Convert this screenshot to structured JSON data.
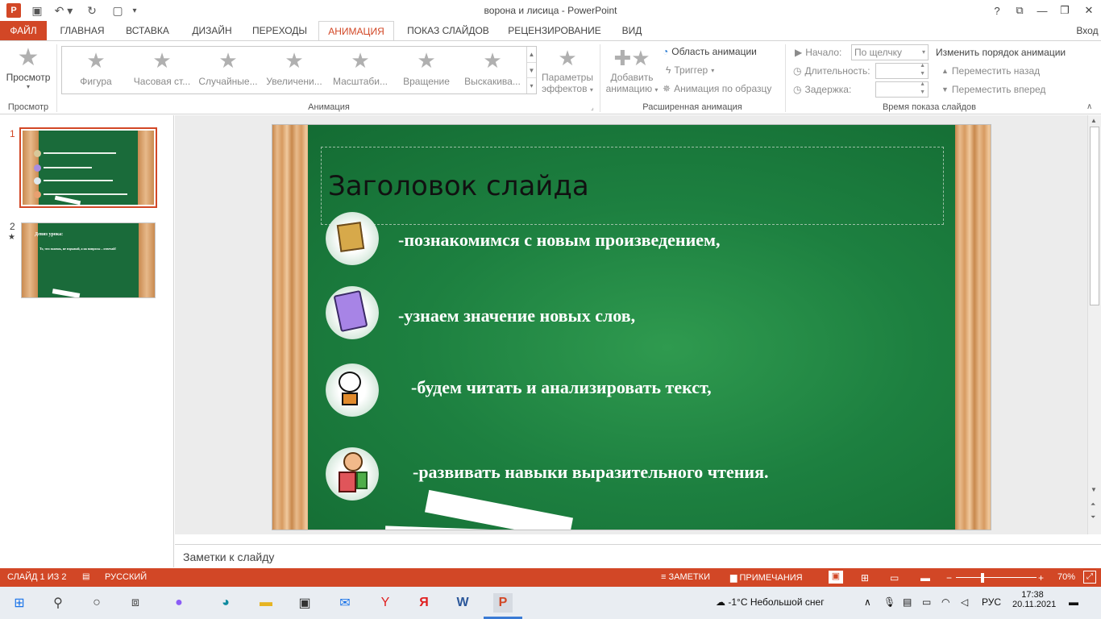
{
  "window": {
    "title": "ворона и лисица - PowerPoint",
    "help": "?",
    "signin": "Вход"
  },
  "tabs": [
    {
      "label": "ФАЙЛ"
    },
    {
      "label": "ГЛАВНАЯ"
    },
    {
      "label": "ВСТАВКА"
    },
    {
      "label": "ДИЗАЙН"
    },
    {
      "label": "ПЕРЕХОДЫ"
    },
    {
      "label": "АНИМАЦИЯ"
    },
    {
      "label": "ПОКАЗ СЛАЙДОВ"
    },
    {
      "label": "РЕЦЕНЗИРОВАНИЕ"
    },
    {
      "label": "ВИД"
    }
  ],
  "ribbon": {
    "preview_label": "Просмотр",
    "preview_group": "Просмотр",
    "animation_group": "Анимация",
    "gallery": [
      {
        "label": "Фигура"
      },
      {
        "label": "Часовая ст..."
      },
      {
        "label": "Случайные..."
      },
      {
        "label": "Увеличени..."
      },
      {
        "label": "Масштаби..."
      },
      {
        "label": "Вращение"
      },
      {
        "label": "Выскакива..."
      }
    ],
    "effects_label1": "Параметры",
    "effects_label2": "эффектов",
    "add_anim_label1": "Добавить",
    "add_anim_label2": "анимацию",
    "anim_pane": "Область анимации",
    "trigger": "Триггер",
    "anim_painter": "Анимация по образцу",
    "advanced_group": "Расширенная анимация",
    "start_label": "Начало:",
    "start_value": "По щелчку",
    "duration_label": "Длительность:",
    "delay_label": "Задержка:",
    "timing_group": "Время показа слайдов",
    "reorder_title": "Изменить порядок анимации",
    "move_back": "Переместить назад",
    "move_forward": "Переместить вперед"
  },
  "thumbnails": [
    {
      "num": "1",
      "star": ""
    },
    {
      "num": "2",
      "star": "★"
    }
  ],
  "thumb2_text": {
    "title": "Девиз урока:",
    "line": "То, что знаешь, не взрывай, а на вопросы – отвечай!"
  },
  "slide": {
    "title": "Заголовок слайда",
    "bullets": [
      {
        "text": "-познакомимся с новым произведением,"
      },
      {
        "text": "-узнаем значение новых слов,"
      },
      {
        "text": "-будем читать и анализировать текст,"
      },
      {
        "text": "-развивать навыки выразительного чтения."
      }
    ]
  },
  "notes_placeholder": "Заметки к слайду",
  "status": {
    "slide": "СЛАЙД 1 ИЗ 2",
    "lang": "РУССКИЙ",
    "notes": "ЗАМЕТКИ",
    "comments": "ПРИМЕЧАНИЯ",
    "zoom": "70%"
  },
  "taskbar": {
    "weather": "-1°C  Небольшой снег",
    "lang": "РУС",
    "time": "17:38",
    "date": "20.11.2021"
  }
}
